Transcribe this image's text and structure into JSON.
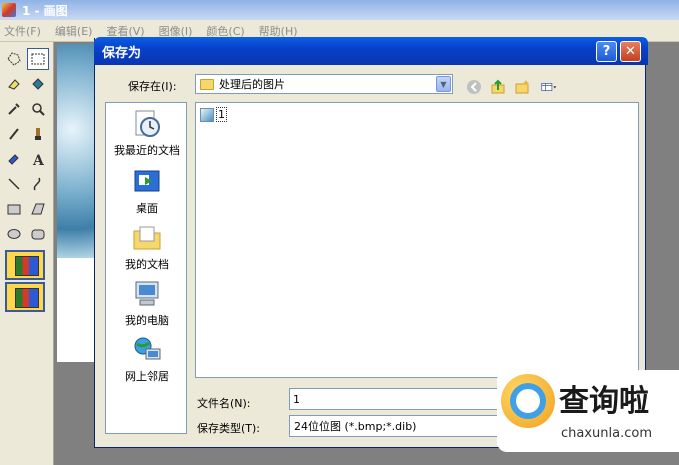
{
  "paint": {
    "title": "1 - 画图",
    "menu": [
      "文件(F)",
      "编辑(E)",
      "查看(V)",
      "图像(I)",
      "颜色(C)",
      "帮助(H)"
    ]
  },
  "dialog": {
    "title": "保存为",
    "help_label": "?",
    "close_label": "✕",
    "save_in_label": "保存在(I):",
    "save_in_value": "处理后的图片",
    "places": [
      "我最近的文档",
      "桌面",
      "我的文档",
      "我的电脑",
      "网上邻居"
    ],
    "files": [
      {
        "name": "1"
      }
    ],
    "filename_label": "文件名(N):",
    "filename_value": "1",
    "filetype_label": "保存类型(T):",
    "filetype_value": "24位位图 (*.bmp;*.dib)"
  },
  "watermark": {
    "title": "查询啦",
    "domain": "chaxunla.com"
  }
}
